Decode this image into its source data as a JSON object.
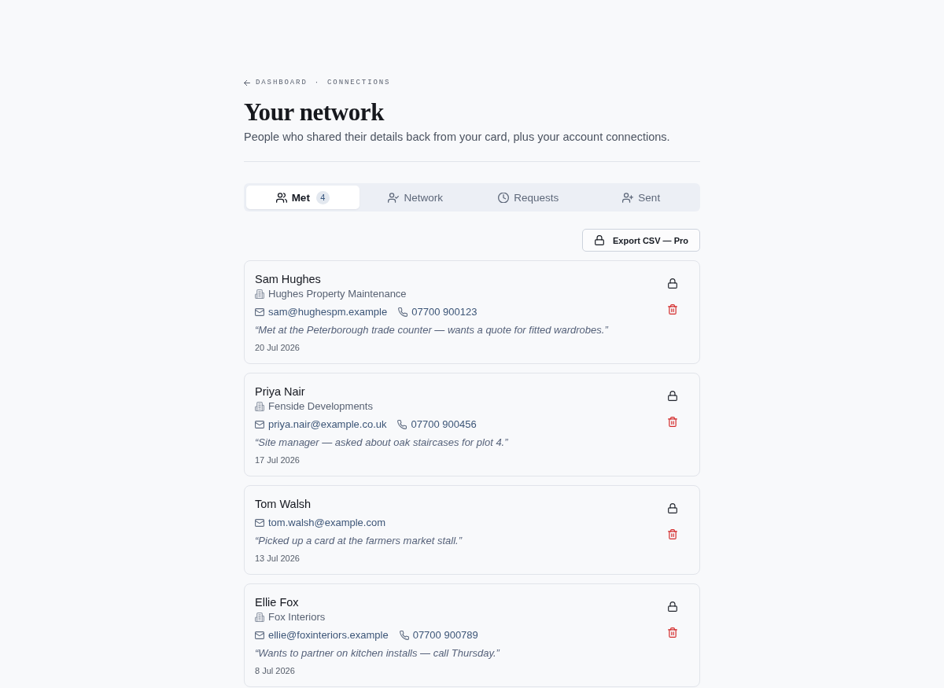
{
  "breadcrumb": {
    "items": [
      {
        "label": "DASHBOARD"
      },
      {
        "label": "CONNECTIONS"
      }
    ],
    "separator": "·"
  },
  "header": {
    "title": "Your network",
    "subtitle": "People who shared their details back from your card, plus your account connections."
  },
  "tabs": [
    {
      "label": "Met",
      "kind": "met",
      "count": "4",
      "selected": true
    },
    {
      "label": "Network",
      "kind": "network",
      "selected": false
    },
    {
      "label": "Requests",
      "kind": "requests",
      "selected": false
    },
    {
      "label": "Sent",
      "kind": "sent",
      "selected": false
    }
  ],
  "export_button": {
    "label": "Export CSV — Pro"
  },
  "contacts": [
    {
      "name": "Sam Hughes",
      "company": "Hughes Property Maintenance",
      "email": "sam@hughespm.example",
      "phone": "07700 900123",
      "note": "“Met at the Peterborough trade counter — wants a quote for fitted wardrobes.”",
      "date": "20 Jul 2026"
    },
    {
      "name": "Priya Nair",
      "company": "Fenside Developments",
      "email": "priya.nair@example.co.uk",
      "phone": "07700 900456",
      "note": "“Site manager — asked about oak staircases for plot 4.”",
      "date": "17 Jul 2026"
    },
    {
      "name": "Tom Walsh",
      "email": "tom.walsh@example.com",
      "note": "“Picked up a card at the farmers market stall.”",
      "date": "13 Jul 2026"
    },
    {
      "name": "Ellie Fox",
      "company": "Fox Interiors",
      "email": "ellie@foxinteriors.example",
      "phone": "07700 900789",
      "note": "“Wants to partner on kitchen installs — call Thursday.”",
      "date": "8 Jul 2026"
    }
  ]
}
